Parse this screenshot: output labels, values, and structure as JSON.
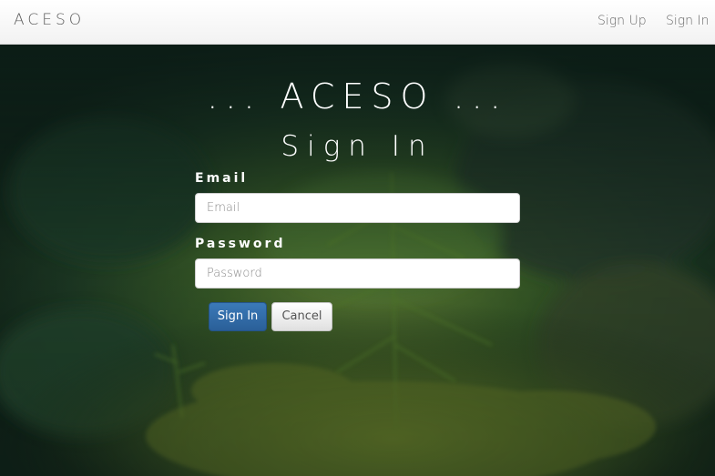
{
  "navbar": {
    "brand": "ACESO",
    "links": [
      {
        "label": "Sign Up"
      },
      {
        "label": "Sign In"
      }
    ]
  },
  "hero": {
    "app_title": "... ACESO ...",
    "form_title": "Sign In"
  },
  "form": {
    "email": {
      "label": "Email",
      "placeholder": "Email",
      "value": ""
    },
    "password": {
      "label": "Password",
      "placeholder": "Password",
      "value": ""
    },
    "buttons": {
      "submit": "Sign In",
      "cancel": "Cancel"
    }
  },
  "colors": {
    "navbar_bg": "#f8f8f8",
    "primary_button": "#2f6aa6",
    "hero_text": "#ffffff"
  }
}
